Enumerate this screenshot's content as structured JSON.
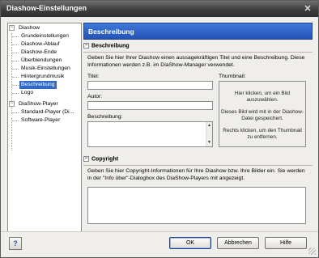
{
  "window": {
    "title": "Diashow-Einstellungen",
    "close_glyph": "✕"
  },
  "tree": {
    "root1": {
      "label": "Diashow",
      "toggle": "−"
    },
    "root1_children": [
      {
        "label": "Grundeinstellungen",
        "selected": false
      },
      {
        "label": "Diashow-Ablauf",
        "selected": false
      },
      {
        "label": "Diashow-Ende",
        "selected": false
      },
      {
        "label": "Überblendungen",
        "selected": false
      },
      {
        "label": "Musik-Einstellungen",
        "selected": false
      },
      {
        "label": "Hintergrundmusik",
        "selected": false
      },
      {
        "label": "Beschreibung",
        "selected": true
      },
      {
        "label": "Logo",
        "selected": false
      }
    ],
    "root2": {
      "label": "DiaShow-Player",
      "toggle": "−"
    },
    "root2_children": [
      {
        "label": "Standard-Player (Di...",
        "selected": false
      },
      {
        "label": "Software-Player",
        "selected": false
      }
    ]
  },
  "panel": {
    "header": "Beschreibung",
    "section1": {
      "toggle": "−",
      "title": "Beschreibung",
      "description": "Geben Sie hier Ihrer Diashow einen aussagekräftigen Titel und eine Beschreibung. Diese Informationen werden z.B. im DiaShow-Manager verwendet.",
      "title_label": "Titel:",
      "title_value": "",
      "author_label": "Autor:",
      "author_value": "",
      "desc_label": "Beschreibung:",
      "desc_value": "",
      "thumb_label": "Thumbnail:",
      "thumb_line1": "Hier klicken, um ein Bild auszuwählen.",
      "thumb_line2": "Dieses Bild wird mit in der Diashow-Datei gespeichert.",
      "thumb_line3": "Rechts klicken, um den Thumbnail zu entfernen."
    },
    "section2": {
      "toggle": "−",
      "title": "Copyright",
      "description": "Geben Sie hier Copyright-Informationen für Ihre Diashow bzw. Ihre Bilder ein. Sie werden in der \"Info über\"-Dialogbox des DiaShow-Players mit angezeigt.",
      "value": ""
    }
  },
  "buttons": {
    "help_icon": "?",
    "ok": "OK",
    "cancel": "Abbrechen",
    "help": "Hilfe"
  },
  "colors": {
    "accent": "#2a5cbf",
    "selection": "#316ac5",
    "dialog_bg": "#f0eeea"
  }
}
